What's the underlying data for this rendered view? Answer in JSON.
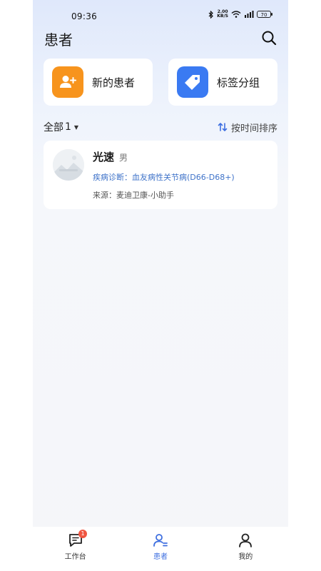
{
  "status_bar": {
    "time": "09:36",
    "net_speed_value": "2.00",
    "net_speed_unit": "KB/S",
    "battery": "70",
    "icons": [
      "bluetooth-icon",
      "wifi-icon",
      "signal-icon",
      "battery-icon"
    ]
  },
  "header": {
    "title": "患者",
    "search_icon": "search-icon"
  },
  "actions": [
    {
      "label": "新的患者",
      "icon": "add-user-icon",
      "color": "#f7941d"
    },
    {
      "label": "标签分组",
      "icon": "tag-icon",
      "color": "#3a7af2"
    }
  ],
  "filter": {
    "label": "全部",
    "count": "1",
    "sort_label": "按时间排序"
  },
  "patients": [
    {
      "name": "光速",
      "gender": "男",
      "diagnosis": "疾病诊断：血友病性关节病(D66-D68+)",
      "source": "来源：麦迪卫康-小助手"
    }
  ],
  "bottom_nav": [
    {
      "label": "工作台",
      "icon": "workbench-icon",
      "badge": "1"
    },
    {
      "label": "患者",
      "icon": "patients-icon",
      "active": true
    },
    {
      "label": "我的",
      "icon": "profile-icon"
    }
  ],
  "colors": {
    "accent": "#3e6fe0",
    "diagnosis": "#3f73c9",
    "badge": "#ef5541"
  }
}
